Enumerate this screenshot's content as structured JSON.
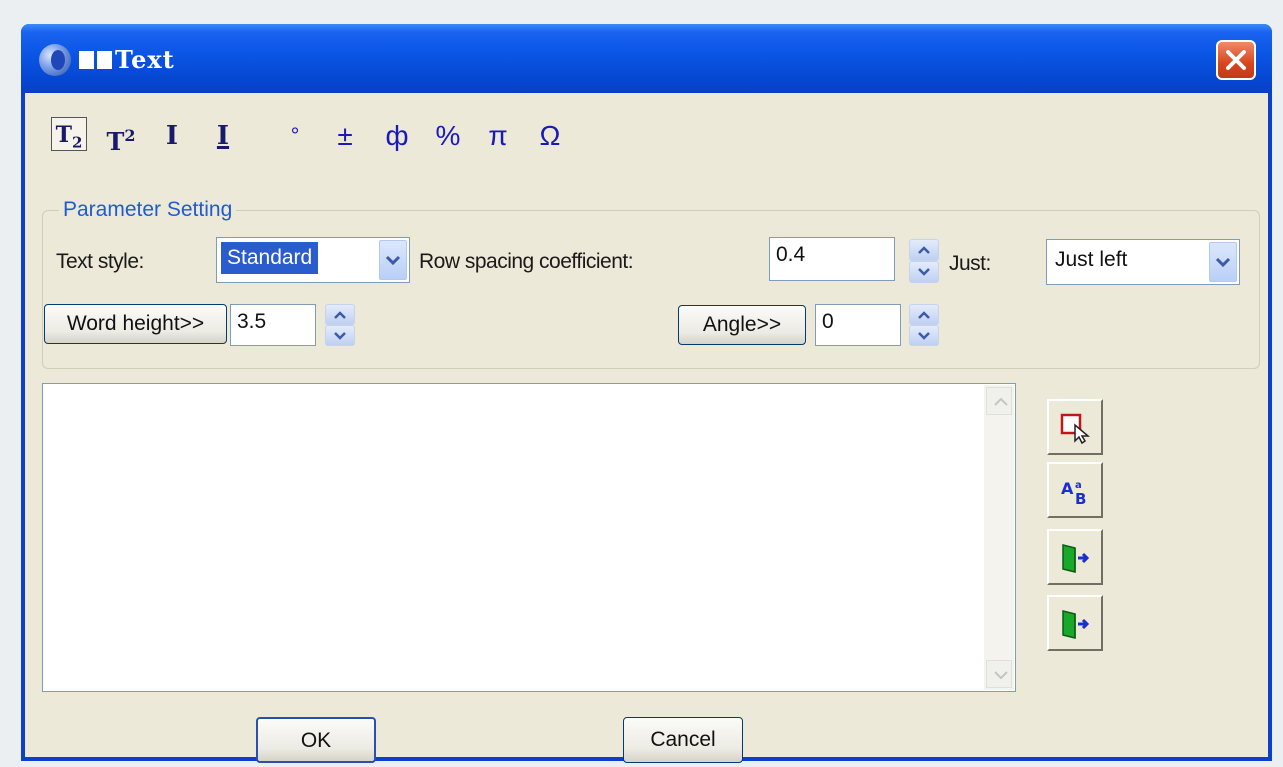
{
  "window": {
    "title": "Text",
    "title_prefix_glyphs": 2,
    "close_icon": "close-icon"
  },
  "toolbar": {
    "subscript": {
      "base": "T",
      "sub": "2",
      "icon": "subscript-icon"
    },
    "superscript": {
      "base": "T",
      "sup": "2",
      "icon": "superscript-icon"
    },
    "insert_i": {
      "glyph": "I",
      "icon": "text-cursor-icon"
    },
    "insert_i_underline": {
      "glyph": "I",
      "icon": "underline-text-icon"
    },
    "symbols": [
      "°",
      "±",
      "ф",
      "%",
      "π",
      "Ω"
    ]
  },
  "group": {
    "title": "Parameter Setting",
    "text_style_label": "Text style:",
    "text_style_value": "Standard",
    "row_spacing_label": "Row spacing coefficient:",
    "row_spacing_value": "0.4",
    "just_label": "Just:",
    "just_value": "Just left",
    "word_height_button": "Word height>>",
    "word_height_value": "3.5",
    "angle_button": "Angle>>",
    "angle_value": "0"
  },
  "text_area": {
    "value": ""
  },
  "side_buttons": [
    "pick-object-icon",
    "text-format-icon",
    "import-icon",
    "export-icon"
  ],
  "buttons": {
    "ok": "OK",
    "cancel": "Cancel"
  },
  "colors": {
    "titlebar": "#0a55e4",
    "dialog_face": "#ece9d8",
    "close_button": "#d8451f",
    "group_title": "#1f5bd1",
    "selection": "#2a5ccd",
    "symbol_blue": "#1a1ab8"
  }
}
